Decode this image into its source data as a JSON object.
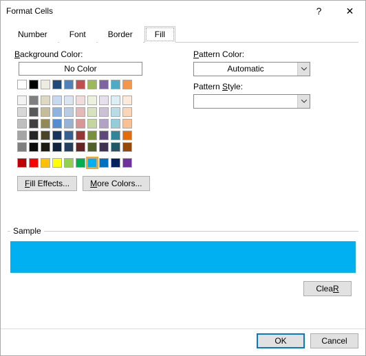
{
  "titlebar": {
    "title": "Format Cells",
    "help": "?",
    "close": "✕"
  },
  "tabs": {
    "number": "Number",
    "font": "Font",
    "border": "Border",
    "fill": "Fill",
    "active": "fill"
  },
  "left": {
    "bg_label": "Background Color:",
    "nocolor": "No Color",
    "fill_effects": "Fill Effects...",
    "more_colors": "More Colors..."
  },
  "right": {
    "pattern_color_label": "Pattern Color:",
    "pattern_color_value": "Automatic",
    "pattern_style_label": "Pattern Style:",
    "pattern_style_value": ""
  },
  "palette": {
    "row_top": [
      "#ffffff",
      "#000000",
      "#eeece1",
      "#1f497d",
      "#4f81bd",
      "#c0504d",
      "#9bbb59",
      "#8064a2",
      "#4bacc6",
      "#f79646"
    ],
    "rows_mid": [
      [
        "#f2f2f2",
        "#7f7f7f",
        "#ddd9c3",
        "#c6d9f0",
        "#dbe5f1",
        "#f2dcdb",
        "#ebf1dd",
        "#e5e0ec",
        "#dbeef3",
        "#fdeada"
      ],
      [
        "#d8d8d8",
        "#595959",
        "#c4bd97",
        "#8db3e2",
        "#b8cce4",
        "#e5b9b7",
        "#d7e3bc",
        "#ccc1d9",
        "#b7dde8",
        "#fbd5b5"
      ],
      [
        "#bfbfbf",
        "#3f3f3f",
        "#938953",
        "#548dd4",
        "#95b3d7",
        "#d99694",
        "#c3d69b",
        "#b2a2c7",
        "#92cddc",
        "#fac08f"
      ],
      [
        "#a5a5a5",
        "#262626",
        "#494429",
        "#17365d",
        "#366092",
        "#953734",
        "#76923c",
        "#5f497a",
        "#31859b",
        "#e36c09"
      ],
      [
        "#7f7f7f",
        "#0c0c0c",
        "#1d1b10",
        "#0f243e",
        "#244061",
        "#632423",
        "#4f6128",
        "#3f3151",
        "#205867",
        "#974806"
      ]
    ],
    "row_std": [
      "#c00000",
      "#ff0000",
      "#ffc000",
      "#ffff00",
      "#92d050",
      "#00b050",
      "#00b0f0",
      "#0070c0",
      "#002060",
      "#7030a0"
    ],
    "selected_hex": "#00b0f0"
  },
  "sample": {
    "label": "Sample",
    "color": "#00b0f0"
  },
  "buttons": {
    "clear": "Clear",
    "ok": "OK",
    "cancel": "Cancel"
  },
  "letters": {
    "b": "B",
    "c": "C",
    "f": "F",
    "m": "M",
    "r": "R",
    "s": "S",
    "p": "P"
  }
}
